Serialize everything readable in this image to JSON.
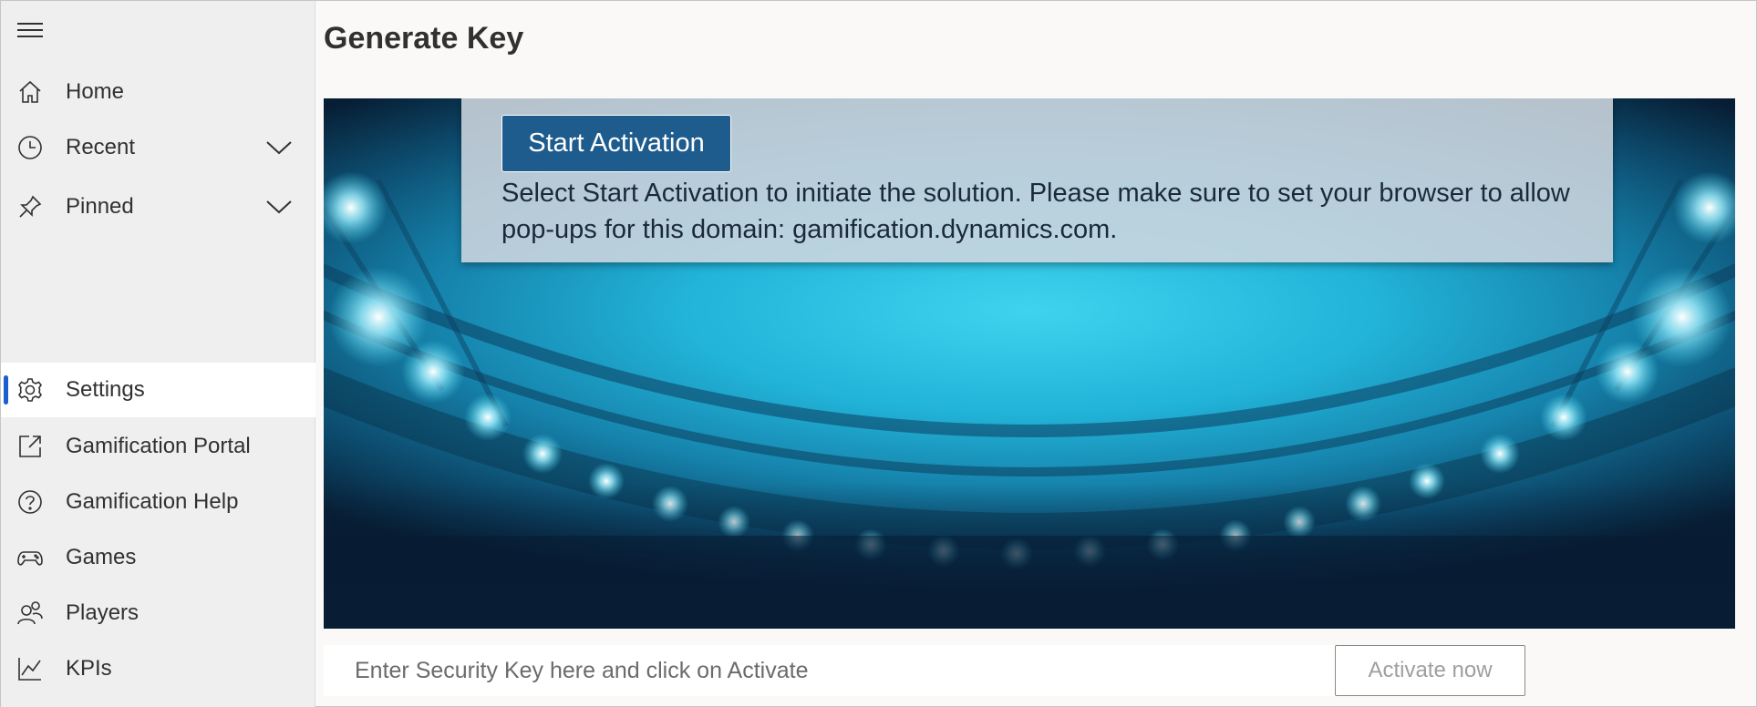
{
  "sidebar": {
    "menu_icon": "hamburger-menu-icon",
    "items": [
      {
        "label": "Home",
        "icon": "home-icon"
      },
      {
        "label": "Recent",
        "icon": "clock-icon",
        "expandable": true
      },
      {
        "label": "Pinned",
        "icon": "pin-icon",
        "expandable": true
      },
      {
        "label": "Settings",
        "icon": "gear-icon",
        "active": true
      },
      {
        "label": "Gamification Portal",
        "icon": "external-link-icon"
      },
      {
        "label": "Gamification Help",
        "icon": "help-circle-icon"
      },
      {
        "label": "Games",
        "icon": "gamepad-icon"
      },
      {
        "label": "Players",
        "icon": "people-icon"
      },
      {
        "label": "KPIs",
        "icon": "line-chart-icon"
      }
    ]
  },
  "main": {
    "title": "Generate Key",
    "activation": {
      "button_label": "Start Activation",
      "instructions": "Select Start Activation to initiate the solution. Please make sure to set your browser to allow pop-ups for this domain: gamification.dynamics.com."
    },
    "security_key": {
      "placeholder": "Enter Security Key here and click on Activate",
      "value": ""
    },
    "activate_button_label": "Activate now"
  },
  "colors": {
    "accent": "#1a5fd0",
    "start_button": "#1f5c8e",
    "hero_cyan": "#22b4d9"
  }
}
